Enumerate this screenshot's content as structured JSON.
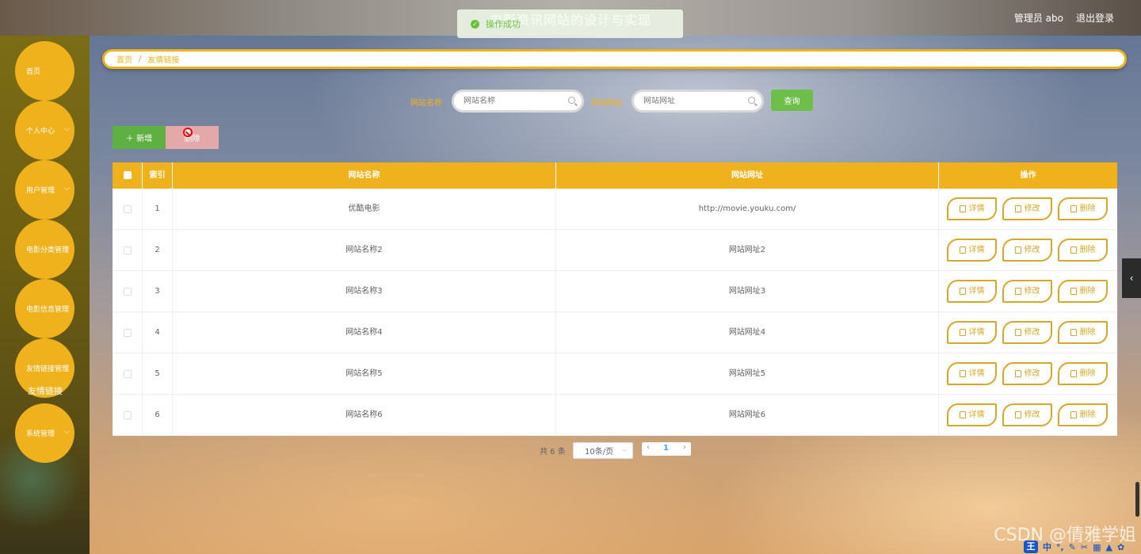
{
  "header": {
    "title": "电影资讯网站的设计与实现",
    "user_label": "管理员 abo",
    "logout_label": "退出登录"
  },
  "toast": {
    "message": "操作成功"
  },
  "sidebar": {
    "items": [
      {
        "label": "首页",
        "has_children": false
      },
      {
        "label": "个人中心",
        "has_children": true
      },
      {
        "label": "用户管理",
        "has_children": true
      },
      {
        "label": "电影分类管理",
        "has_children": false
      },
      {
        "label": "电影信息管理",
        "has_children": false
      },
      {
        "label": "友情链接管理",
        "has_children": false
      },
      {
        "label": "系统管理",
        "has_children": true
      }
    ],
    "sub_item": "友情链接"
  },
  "breadcrumb": {
    "home": "首页",
    "separator": "/",
    "current": "友情链接"
  },
  "search": {
    "name_label": "网站名称",
    "name_placeholder": "网站名称",
    "url_label": "网站网址",
    "url_placeholder": "网站网址",
    "query_label": "查询"
  },
  "toolbar": {
    "add_label": "＋ 新增",
    "delete_label": "删除"
  },
  "table": {
    "columns": [
      "索引",
      "网站名称",
      "网站网址",
      "操作"
    ],
    "rows": [
      {
        "index": "1",
        "name": "优酷电影",
        "url": "http://movie.youku.com/"
      },
      {
        "index": "2",
        "name": "网站名称2",
        "url": "网站网址2"
      },
      {
        "index": "3",
        "name": "网站名称3",
        "url": "网站网址3"
      },
      {
        "index": "4",
        "name": "网站名称4",
        "url": "网站网址4"
      },
      {
        "index": "5",
        "name": "网站名称5",
        "url": "网站网址5"
      },
      {
        "index": "6",
        "name": "网站名称6",
        "url": "网站网址6"
      }
    ],
    "actions": {
      "detail": "详情",
      "edit": "修改",
      "delete": "删除"
    }
  },
  "pagination": {
    "total": "共 6 条",
    "page_size": "10条/页",
    "current_page": "1"
  },
  "watermark": "CSDN @倩雅学姐",
  "ime": {
    "logo": "王",
    "mode": "中"
  },
  "colors": {
    "accent": "#f0b21c",
    "success": "#67c23a",
    "action_border": "#d6a72a"
  }
}
